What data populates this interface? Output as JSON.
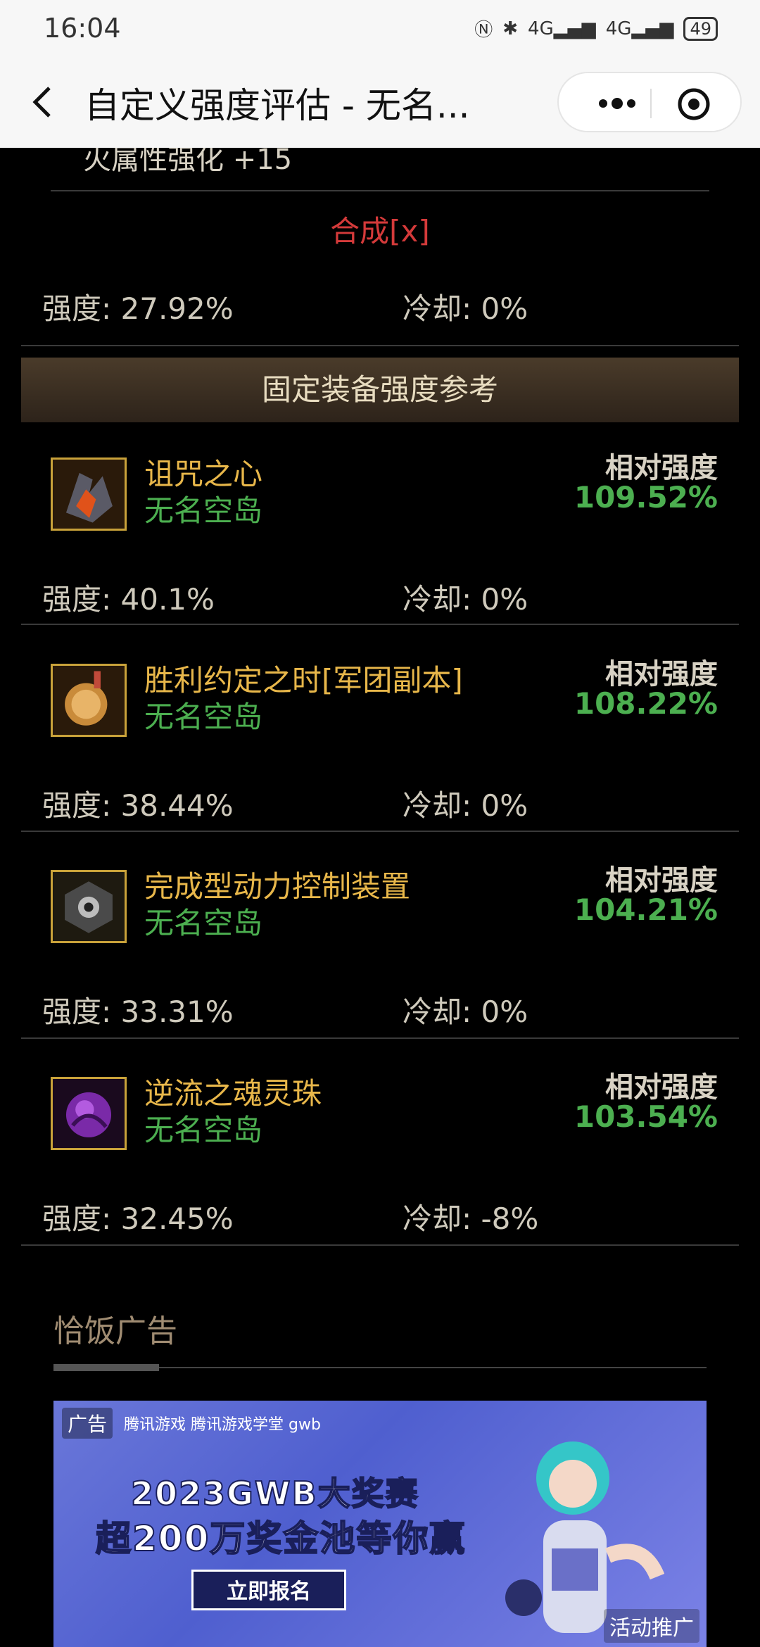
{
  "status_bar": {
    "time": "16:04",
    "network1": "4G",
    "network2": "4G",
    "battery": "49"
  },
  "nav": {
    "title": "自定义强度评估 - 无名..."
  },
  "top_section": {
    "truncated_line": "火属性强化 +15",
    "synthesis_label": "合成[x]",
    "strength": "强度: 27.92%",
    "cooldown": "冷却: 0%"
  },
  "fixed_section": {
    "header": "固定装备强度参考",
    "relative_label": "相对强度",
    "items": [
      {
        "name": "诅咒之心",
        "source": "无名空岛",
        "relative": "109.52%",
        "strength": "强度: 40.1%",
        "cooldown": "冷却: 0%",
        "icon": "cursed-heart-icon"
      },
      {
        "name": "胜利约定之时[军团副本]",
        "source": "无名空岛",
        "relative": "108.22%",
        "strength": "强度: 38.44%",
        "cooldown": "冷却: 0%",
        "icon": "victory-medal-icon"
      },
      {
        "name": "完成型动力控制装置",
        "source": "无名空岛",
        "relative": "104.21%",
        "strength": "强度: 33.31%",
        "cooldown": "冷却: 0%",
        "icon": "power-device-icon"
      },
      {
        "name": "逆流之魂灵珠",
        "source": "无名空岛",
        "relative": "103.54%",
        "strength": "强度: 32.45%",
        "cooldown": "冷却: -8%",
        "icon": "soul-orb-icon"
      }
    ]
  },
  "ad": {
    "title": "恰饭广告",
    "tag": "广告",
    "sponsors": "腾讯游戏  腾讯游戏学堂  gwb",
    "line1": "2023GWB大奖赛",
    "line2": "超200万奖金池等你赢",
    "button": "立即报名",
    "promo": "活动推广"
  }
}
